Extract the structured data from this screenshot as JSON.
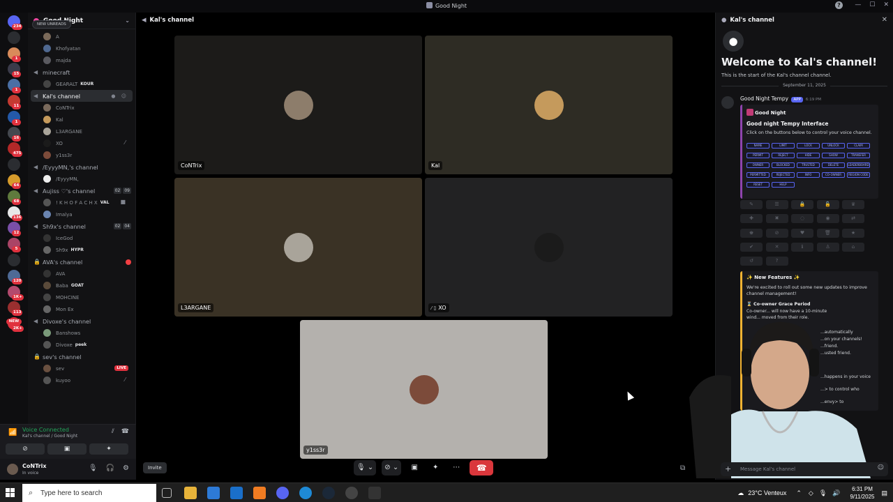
{
  "window": {
    "title": "Good Night"
  },
  "guilds": [
    {
      "badge": "234",
      "color": "#5865f2"
    },
    {
      "badge": "",
      "color": "#2b2d31"
    },
    {
      "badge": "1",
      "color": "#d98b5a"
    },
    {
      "badge": "15",
      "color": "#3b3b4a"
    },
    {
      "badge": "1",
      "color": "#4a6fa5"
    },
    {
      "badge": "11",
      "color": "#c43a31"
    },
    {
      "badge": "1",
      "color": "#2459a8"
    },
    {
      "badge": "16",
      "color": "#44484f"
    },
    {
      "badge": "475",
      "color": "#b32828"
    },
    {
      "badge": "",
      "color": "#2b2d31"
    },
    {
      "badge": "64",
      "color": "#d69b2b"
    },
    {
      "badge": "68",
      "color": "#5f7a3d"
    },
    {
      "badge": "136",
      "color": "#e8e8e8"
    },
    {
      "badge": "12",
      "color": "#7a4fa8"
    },
    {
      "badge": "5",
      "color": "#aa4466"
    },
    {
      "badge": "",
      "color": "#2b2d31"
    },
    {
      "badge": "120",
      "color": "#4e6a96"
    },
    {
      "badge": "1K+",
      "color": "#b34a6e"
    },
    {
      "badge": "113",
      "color": "#9a2f2f"
    },
    {
      "badge": "2K+",
      "color": "#e0313e"
    }
  ],
  "new_badge": "NEW",
  "server": {
    "name": "Good Night",
    "new_unreads": "NEW UNREADS"
  },
  "channel_list": {
    "top_members": [
      "A",
      "Khofyatan",
      "majda"
    ],
    "minecraft": {
      "name": "minecraft",
      "members": [
        {
          "name": "GEARALT",
          "tag": "KOUR"
        }
      ]
    },
    "kals": {
      "name": "Kal's channel",
      "members": [
        "CoNTrix",
        "Kal",
        "L3ARGANE",
        "XO",
        "y1ss3r"
      ]
    },
    "eyyy": {
      "name": "/EyyyMN,'s channel",
      "members": [
        "/EyyyMN,"
      ]
    },
    "aujiss": {
      "name": "Aujiss ♡'s channel",
      "count1": "02",
      "count2": "09",
      "members": [
        {
          "name": "! K H O F A C H X",
          "tag": "VAL"
        },
        {
          "name": "Imalya",
          "tag": ""
        }
      ]
    },
    "sh9x": {
      "name": "Sh9x's channel",
      "count1": "02",
      "count2": "04",
      "members": [
        {
          "name": "IceGod",
          "tag": ""
        },
        {
          "name": "Sh9x",
          "tag": "HYPR"
        }
      ]
    },
    "ava": {
      "name": "AVA's channel",
      "members": [
        {
          "name": "AVA",
          "tag": ""
        },
        {
          "name": "Baba",
          "tag": "GOAT"
        },
        {
          "name": "MOHCINE",
          "tag": ""
        },
        {
          "name": "Mon Ex",
          "tag": ""
        }
      ]
    },
    "divoxe": {
      "name": "Divoxe's channel",
      "members": [
        {
          "name": "Banshows",
          "tag": ""
        },
        {
          "name": "Divoxe",
          "tag": "peek"
        }
      ]
    },
    "sevs": {
      "name": "sev's channel",
      "live": "LIVE",
      "members": [
        "sev",
        "kuyoo"
      ]
    }
  },
  "voice": {
    "status": "Voice Connected",
    "location": "Kal's channel / Good Night"
  },
  "user": {
    "name": "CoNTrix",
    "status": "In voice"
  },
  "stage": {
    "channel": "Kal's channel",
    "tiles": [
      {
        "name": "CoNTrix",
        "bg": "#1c1b19",
        "av": "#8d7d6b"
      },
      {
        "name": "Kal",
        "bg": "#2e2c24",
        "av": "#c59a5c"
      },
      {
        "name": "L3ARGANE",
        "bg": "#3a3225",
        "av": "#a9a49a"
      },
      {
        "name": "XO",
        "bg": "#222223",
        "av": "#1b1b1b"
      },
      {
        "name": "y1ss3r",
        "bg": "#b4b1ad",
        "av": "#7c4b3a"
      }
    ],
    "invite": "Invite"
  },
  "side": {
    "channel": "Kal's channel",
    "welcome": "Welcome to Kal's channel!",
    "start": "This is the start of the Kal's channel channel.",
    "date": "September 11, 2025",
    "bot": {
      "name": "Good Night Tempy",
      "app": "APP",
      "time": "6:19 PM"
    },
    "embed": {
      "server": "Good Night",
      "title": "Good night Tempy Interface",
      "desc": "Click on the buttons below to control your voice channel.",
      "chips": [
        "NAME",
        "LIMIT",
        "LOCK",
        "UNLOCK",
        "CLAIM",
        "PERMIT",
        "REJECT",
        "HIDE",
        "SHOW",
        "TRANSFER",
        "OWNER",
        "BLOCKED",
        "TRUSTED",
        "DELETE",
        "LEADERBOARD",
        "PERMITTED",
        "REJECTED",
        "INFO",
        "CO-OWNER",
        "REGION CODE",
        "RESET",
        "HELP"
      ]
    },
    "features": {
      "title": "✨ New Features ✨",
      "body": "We're excited to roll out some new updates to improve channel management!",
      "sub": "⌛ Co-owner Grace Period",
      "lines": [
        "Co-owner... will now have a 10-minute",
        "wind... moved from their role.",
        "...automatically",
        "...on your channels!",
        "...friend.",
        "...usted friend.",
        "...happens in your voice",
        "...> to control who",
        "...envy> to"
      ]
    },
    "message_placeholder": "Message Kal's channel"
  },
  "taskbar": {
    "search_placeholder": "Type here to search",
    "weather": "23°C Venteux",
    "time": "6:31 PM",
    "date": "9/11/2025"
  }
}
